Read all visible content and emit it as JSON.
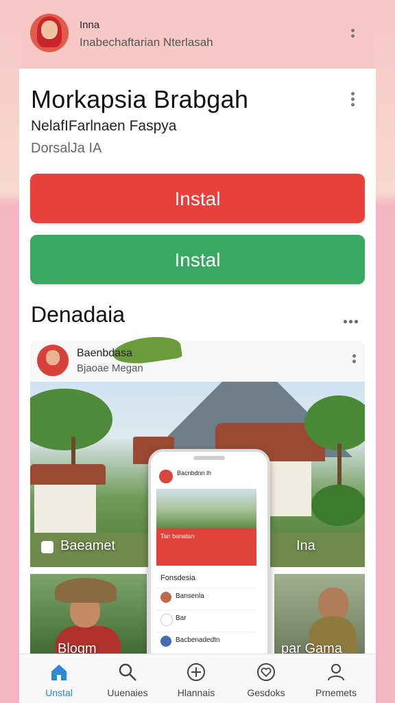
{
  "topbar": {
    "name": "Inna",
    "subtitle": "Inabechaftarian Nterlasah"
  },
  "app": {
    "title": "Morkapsia Brabgah",
    "subtitle": "NelafIFarlnaen Faspya",
    "developer": "DorsalJa IA"
  },
  "buttons": {
    "install_primary": "Instal",
    "install_secondary": "Instal"
  },
  "section": {
    "title": "Denadaia"
  },
  "post": {
    "author": "Baenbdasa",
    "sub": "Bjaoae Megan",
    "photo_labels": {
      "left": "Baeamet",
      "right": "Ina"
    },
    "bottom_labels": {
      "left": "Blogm",
      "right": "par Gama"
    }
  },
  "phone_preview": {
    "header_name": "Bacnbdnn lh",
    "banner_text": "Tan banatan",
    "list_title": "Fonsdesia",
    "rows": [
      "Bansenla",
      "Bar",
      "Bacbenadedtn"
    ]
  },
  "bottom_nav": [
    {
      "label": "Unstal",
      "icon": "home-icon",
      "active": true
    },
    {
      "label": "Uuenaies",
      "icon": "search-icon",
      "active": false
    },
    {
      "label": "Hlannais",
      "icon": "add-icon",
      "active": false
    },
    {
      "label": "Gesdoks",
      "icon": "heart-icon",
      "active": false
    },
    {
      "label": "Prnemets",
      "icon": "profile-icon",
      "active": false
    }
  ],
  "colors": {
    "install_red": "#e8403a",
    "install_green": "#3aa863",
    "nav_active": "#2d8ad1"
  }
}
